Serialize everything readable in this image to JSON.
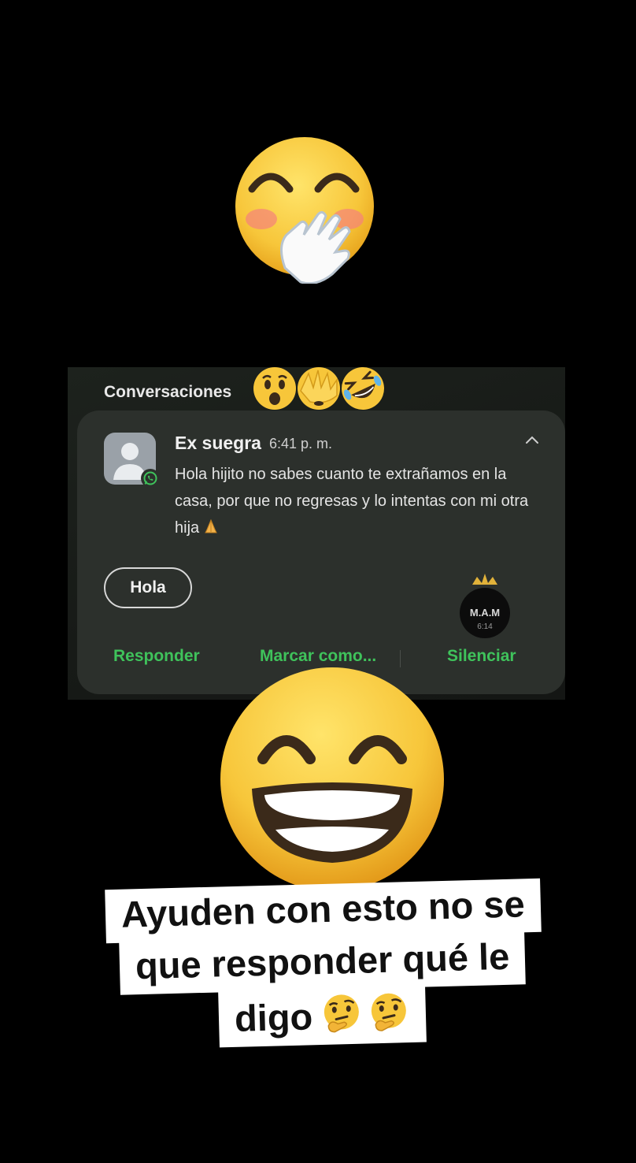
{
  "notification": {
    "section_title": "Conversaciones",
    "sender": "Ex suegra",
    "time": "6:41 p. m.",
    "message": "Hola hijito no sabes cuanto te extrañamos en la casa, por que no regresas y lo intentas con mi otra hija",
    "message_emoji": "folded-hands-icon",
    "quick_reply": "Hola",
    "actions": {
      "reply": "Responder",
      "mark": "Marcar como...",
      "mute": "Silenciar"
    },
    "app_icon": "whatsapp-icon",
    "watermark": {
      "text": "M.A.M",
      "subtext": "6:14"
    }
  },
  "caption": {
    "line1": "Ayuden con esto no se",
    "line2": "que responder qué le",
    "line3": "digo"
  },
  "stickers": {
    "top": "hand-over-mouth-emoji",
    "reactions": [
      "astonished-emoji",
      "face-with-hand-over-eyes-emoji",
      "rofl-emoji"
    ],
    "middle": "beaming-grin-emoji",
    "caption_end": [
      "thinking-face-emoji",
      "thinking-face-emoji"
    ]
  },
  "colors": {
    "background": "#000000",
    "card": "#2c302c",
    "accent_green": "#3fc25b",
    "emoji_yellow": "#f7c63a"
  }
}
